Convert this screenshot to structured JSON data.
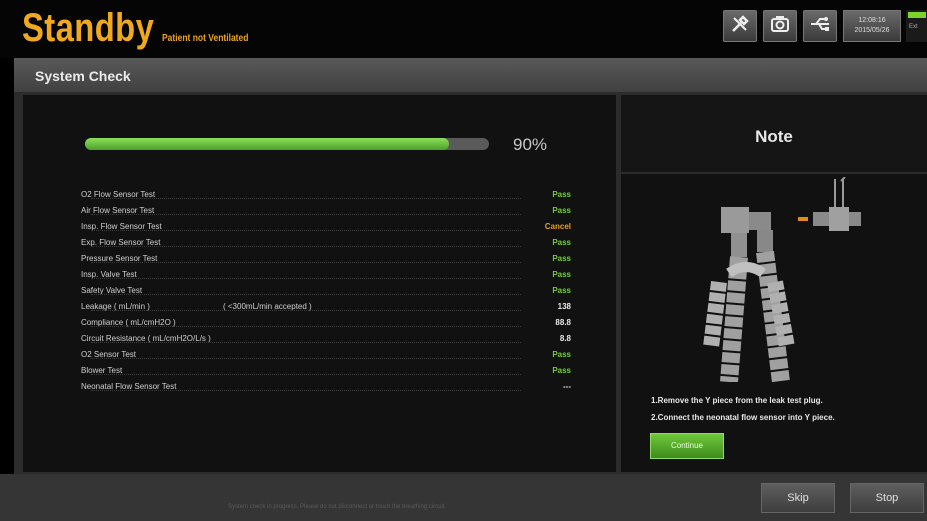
{
  "header": {
    "title": "Standby",
    "subtitle": "Patient not Ventilated",
    "tools_icon": "tools-icon",
    "camera_icon": "camera-icon",
    "usb_icon": "usb-icon",
    "time": "12:08:16",
    "date": "2015/05/26",
    "battery_label": "Ext"
  },
  "panel": {
    "title": "System Check",
    "progress": {
      "percent": 90,
      "label": "90%"
    }
  },
  "tests": [
    {
      "label": "O2 Flow Sensor Test",
      "value": "Pass",
      "status": "pass"
    },
    {
      "label": "Air Flow Sensor Test",
      "value": "Pass",
      "status": "pass"
    },
    {
      "label": "Insp. Flow Sensor Test",
      "value": "Cancel",
      "status": "cancel"
    },
    {
      "label": "Exp. Flow Sensor Test",
      "value": "Pass",
      "status": "pass"
    },
    {
      "label": "Pressure Sensor Test",
      "value": "Pass",
      "status": "pass"
    },
    {
      "label": "Insp. Valve Test",
      "value": "Pass",
      "status": "pass"
    },
    {
      "label": "Safety Valve Test",
      "value": "Pass",
      "status": "pass"
    },
    {
      "label": "Leakage ( mL/min )",
      "range": "( <300mL/min accepted )",
      "value": "138",
      "status": "num"
    },
    {
      "label": "Compliance ( mL/cmH2O )",
      "value": "88.8",
      "status": "num"
    },
    {
      "label": "Circuit Resistance ( mL/cmH2O/L/s )",
      "value": "8.8",
      "status": "num"
    },
    {
      "label": "O2 Sensor Test",
      "value": "Pass",
      "status": "pass"
    },
    {
      "label": "Blower Test",
      "value": "Pass",
      "status": "pass"
    },
    {
      "label": "Neonatal Flow Sensor Test",
      "value": "---",
      "status": "num"
    }
  ],
  "note": {
    "title": "Note",
    "instructions": [
      "1.Remove the Y piece from the leak test plug.",
      "2.Connect the neonatal flow sensor into Y piece."
    ],
    "continue_label": "Continue"
  },
  "footer": {
    "note": "System check in progress. Please do not disconnect or touch the breathing circuit.",
    "skip_label": "Skip",
    "stop_label": "Stop"
  },
  "colors": {
    "title": "#f0a81c",
    "pass": "#6fd22c",
    "cancel": "#e6a21a",
    "progress": "#5cb833"
  }
}
